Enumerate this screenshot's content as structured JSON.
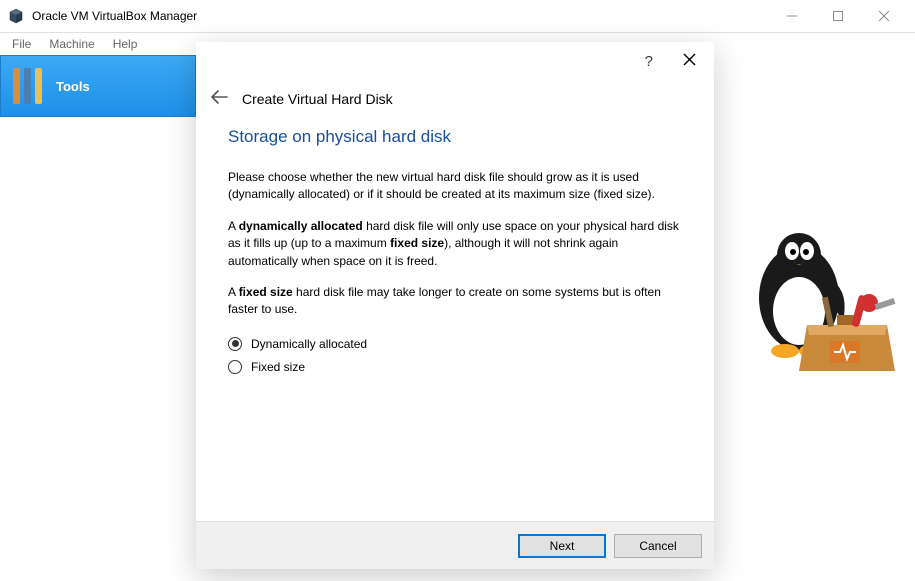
{
  "window": {
    "title": "Oracle VM VirtualBox Manager"
  },
  "menubar": {
    "file": "File",
    "machine": "Machine",
    "help": "Help"
  },
  "sidebar": {
    "tools_label": "Tools"
  },
  "dialog": {
    "title": "Create Virtual Hard Disk",
    "heading": "Storage on physical hard disk",
    "para1": "Please choose whether the new virtual hard disk file should grow as it is used (dynamically allocated) or if it should be created at its maximum size (fixed size).",
    "para2_pre": "A ",
    "para2_bold1": "dynamically allocated",
    "para2_mid": " hard disk file will only use space on your physical hard disk as it fills up (up to a maximum ",
    "para2_bold2": "fixed size",
    "para2_post": "), although it will not shrink again automatically when space on it is freed.",
    "para3_pre": "A ",
    "para3_bold": "fixed size",
    "para3_post": " hard disk file may take longer to create on some systems but is often faster to use.",
    "radio1": "Dynamically allocated",
    "radio2": "Fixed size",
    "next": "Next",
    "cancel": "Cancel"
  }
}
